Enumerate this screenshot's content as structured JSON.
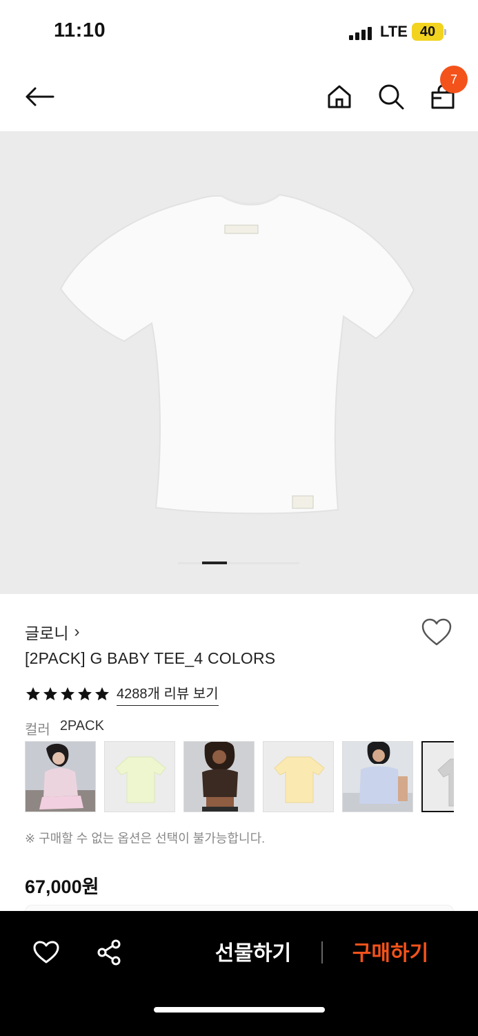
{
  "status_bar": {
    "time": "11:10",
    "network": "LTE",
    "battery": "40"
  },
  "header": {
    "back_icon": "arrow-left-icon",
    "home_icon": "home-icon",
    "search_icon": "search-icon",
    "cart_icon": "shopping-bag-icon",
    "cart_badge": "7"
  },
  "product": {
    "brand": "글로니",
    "brand_chevron": "›",
    "name": "[2PACK] G BABY TEE_4 COLORS",
    "rating_stars": 5,
    "review_link": "4288개 리뷰 보기",
    "color_label": "컬러",
    "color_value": "2PACK",
    "notice": "※ 구매할 수 없는 옵션은 선택이 불가능합니다.",
    "price": "67,000원",
    "image_pager": {
      "current": 1
    }
  },
  "swatches": [
    {
      "name": "pink-model"
    },
    {
      "name": "lime-tee"
    },
    {
      "name": "brown-model"
    },
    {
      "name": "yellow-tee"
    },
    {
      "name": "blue-model"
    },
    {
      "name": "gray-tee",
      "selected": true
    }
  ],
  "bottom_bar": {
    "wish_icon": "heart-icon",
    "share_icon": "share-icon",
    "gift_label": "선물하기",
    "buy_label": "구매하기"
  },
  "colors": {
    "accent": "#f4521b",
    "bottom_bar_bg": "#000000",
    "image_bg": "#ebebeb"
  }
}
